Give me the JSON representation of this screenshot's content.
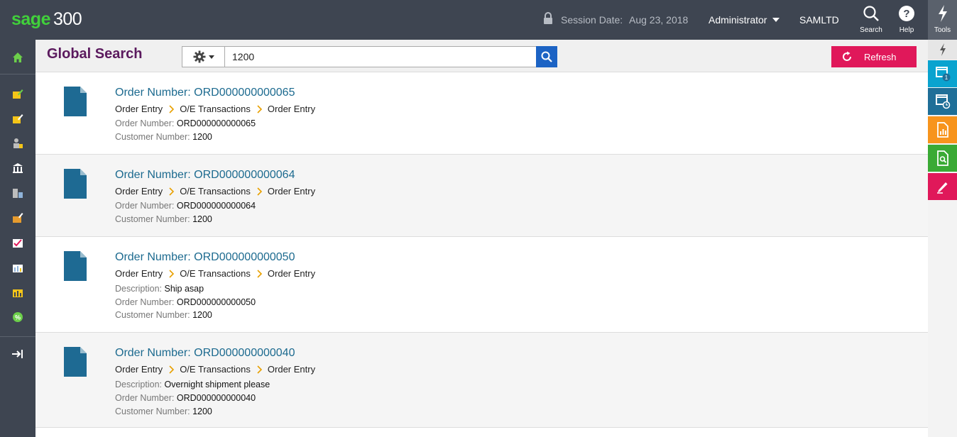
{
  "app": {
    "logo_brand": "sage",
    "logo_version": "300",
    "session_label": "Session Date:",
    "session_date": "Aug 23, 2018",
    "user": "Administrator",
    "company": "SAMLTD",
    "search_label": "Search",
    "help_label": "Help",
    "tools_label": "Tools"
  },
  "header": {
    "title": "Global Search",
    "search_value": "1200",
    "refresh_label": "Refresh"
  },
  "rail": {
    "window_badge": "1"
  },
  "results": [
    {
      "title": "Order Number: ORD000000000065",
      "crumbs": [
        "Order Entry",
        "O/E Transactions",
        "Order Entry"
      ],
      "fields": [
        {
          "k": "Order Number:",
          "v": "ORD000000000065"
        },
        {
          "k": "Customer Number:",
          "v": "1200"
        }
      ]
    },
    {
      "title": "Order Number: ORD000000000064",
      "crumbs": [
        "Order Entry",
        "O/E Transactions",
        "Order Entry"
      ],
      "fields": [
        {
          "k": "Order Number:",
          "v": "ORD000000000064"
        },
        {
          "k": "Customer Number:",
          "v": "1200"
        }
      ]
    },
    {
      "title": "Order Number: ORD000000000050",
      "crumbs": [
        "Order Entry",
        "O/E Transactions",
        "Order Entry"
      ],
      "fields": [
        {
          "k": "Description:",
          "v": "Ship asap"
        },
        {
          "k": "Order Number:",
          "v": "ORD000000000050"
        },
        {
          "k": "Customer Number:",
          "v": "1200"
        }
      ]
    },
    {
      "title": "Order Number: ORD000000000040",
      "crumbs": [
        "Order Entry",
        "O/E Transactions",
        "Order Entry"
      ],
      "fields": [
        {
          "k": "Description:",
          "v": "Overnight shipment please"
        },
        {
          "k": "Order Number:",
          "v": "ORD000000000040"
        },
        {
          "k": "Customer Number:",
          "v": "1200"
        }
      ]
    }
  ],
  "icons": {
    "lock": "lock-icon",
    "search": "search-icon",
    "help": "help-icon",
    "tools": "lightning-icon",
    "gear": "gear-icon",
    "refresh": "refresh-icon",
    "document": "document-icon",
    "chevron": "chevron-right-icon"
  },
  "colors": {
    "topbar": "#3e4551",
    "brand_green": "#41d03b",
    "title_purple": "#5b1a5e",
    "link_blue": "#1c6a8f",
    "search_blue": "#1c63c4",
    "refresh_pink": "#e0185a",
    "rail_teal": "#0aa3cf",
    "rail_blue": "#1f6f98",
    "rail_orange": "#f7941d",
    "rail_green": "#3aaa35",
    "rail_pink": "#e0185a",
    "chevron_orange": "#e8a000"
  }
}
